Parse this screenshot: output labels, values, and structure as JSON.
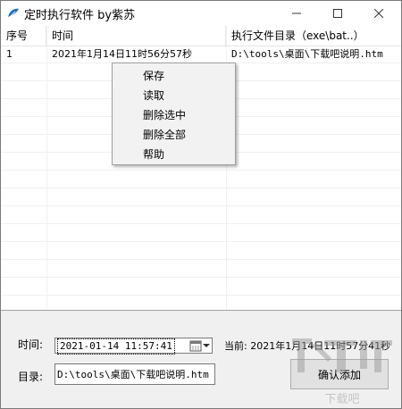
{
  "window": {
    "title": "定时执行软件 by紫苏",
    "icon": "leaf-icon",
    "controls": {
      "minimize": "minimize-icon",
      "maximize": "maximize-icon",
      "close": "close-icon"
    }
  },
  "table": {
    "headers": [
      "序号",
      "时间",
      "执行文件目录（exe\\bat..）"
    ],
    "rows": [
      {
        "seq": "1",
        "time": "2021年1月14日11时56分57秒",
        "dir": "D:\\tools\\桌面\\下载吧说明.htm"
      }
    ]
  },
  "context_menu": {
    "items": [
      "保存",
      "读取",
      "删除选中",
      "删除全部",
      "帮助"
    ]
  },
  "form": {
    "time_label": "时间:",
    "time_value": "2021-01-14 11:57:41",
    "dir_label": "目录:",
    "dir_value": "D:\\tools\\桌面\\下载吧说明.htm",
    "now_text": "当前: 2021年1月14日11时57分41秒",
    "add_button": "确认添加"
  },
  "watermark": {
    "text": "下载吧",
    "icon": "download-watermark-icon"
  },
  "colors": {
    "window_bg": "#f0f0f0",
    "list_bg": "#ffffff",
    "menu_bg": "#f2f2f2",
    "button_bg": "#e1e1e1",
    "icon_blue": "#1e6fb8"
  }
}
